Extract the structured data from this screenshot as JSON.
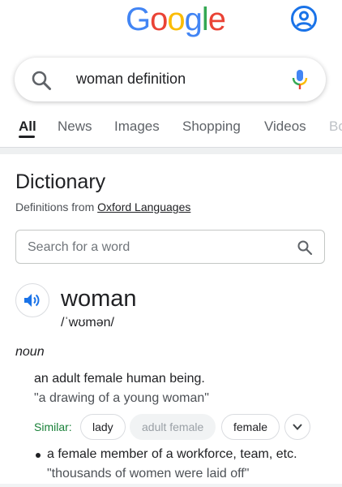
{
  "header": {
    "logo_letters": [
      {
        "char": "G",
        "color": "#4285F4"
      },
      {
        "char": "o",
        "color": "#EA4335"
      },
      {
        "char": "o",
        "color": "#FBBC05"
      },
      {
        "char": "g",
        "color": "#4285F4"
      },
      {
        "char": "l",
        "color": "#34A853"
      },
      {
        "char": "e",
        "color": "#EA4335"
      }
    ],
    "account_icon": "account-circle-icon",
    "account_color": "#1a73e8"
  },
  "search": {
    "query": "woman definition",
    "search_icon": "search-icon",
    "mic_icon": "mic-icon"
  },
  "tabs": [
    {
      "label": "All",
      "active": true
    },
    {
      "label": "News",
      "active": false
    },
    {
      "label": "Images",
      "active": false
    },
    {
      "label": "Shopping",
      "active": false
    },
    {
      "label": "Videos",
      "active": false
    },
    {
      "label": "Bo",
      "active": false
    }
  ],
  "dictionary": {
    "title": "Dictionary",
    "source_prefix": "Definitions from ",
    "source_link": "Oxford Languages",
    "search_placeholder": "Search for a word",
    "headword": "woman",
    "phonetic": "/ˈwʊmən/",
    "part_of_speech": "noun",
    "senses": [
      {
        "definition": "an adult female human being.",
        "example": "\"a drawing of a young woman\"",
        "similar_label": "Similar:",
        "similar": [
          {
            "word": "lady",
            "muted": false
          },
          {
            "word": "adult female",
            "muted": true
          },
          {
            "word": "female",
            "muted": false
          }
        ]
      },
      {
        "definition": "a female member of a workforce, team, etc.",
        "example": "\"thousands of women were laid off\""
      }
    ]
  },
  "colors": {
    "accent": "#1a73e8",
    "similar_green": "#188038",
    "muted_text": "#4d5156"
  }
}
